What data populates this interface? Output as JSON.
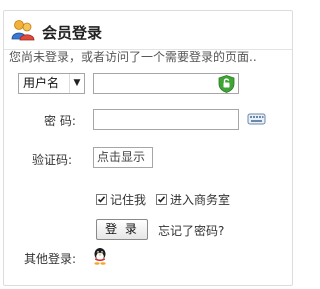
{
  "header": {
    "title": "会员登录",
    "icon": "users-icon"
  },
  "notice": "您尚未登录，或者访问了一个需要登录的页面..",
  "login_type": {
    "selected": "用户名",
    "options": [
      "用户名"
    ]
  },
  "username": {
    "value": "",
    "icon": "shield-icon"
  },
  "password": {
    "label": "密  码:",
    "value": "",
    "icon": "keyboard-icon"
  },
  "captcha": {
    "label": "验证码:",
    "value": "点击显示"
  },
  "options": [
    {
      "label": "记住我",
      "checked": true
    },
    {
      "label": "进入商务室",
      "checked": true
    }
  ],
  "login_button": "登 录",
  "forgot_link": "忘记了密码?",
  "other_login": {
    "label": "其他登录:",
    "icon": "qq-icon"
  },
  "colors": {
    "accent_green": "#3fa535",
    "border": "#a6a6a6"
  }
}
